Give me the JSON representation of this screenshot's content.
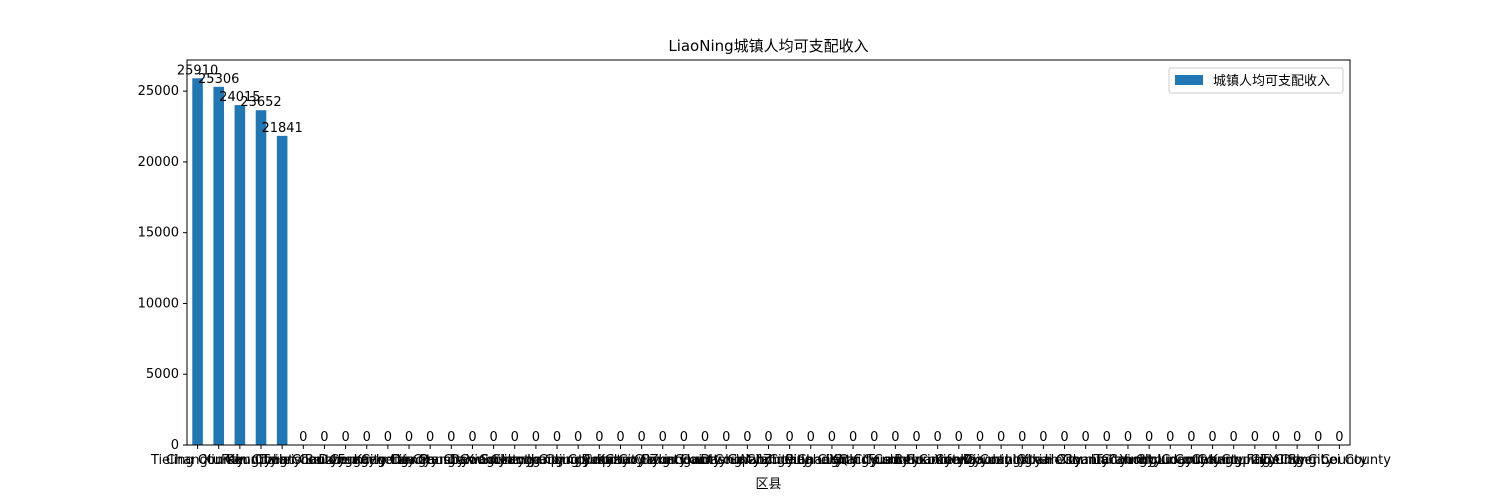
{
  "chart_data": {
    "type": "bar",
    "title": "LiaoNing城镇人均可支配收入",
    "xlabel": "区县",
    "ylabel": "",
    "ylim": [
      0,
      27200
    ],
    "yticks": [
      0,
      5000,
      10000,
      15000,
      20000,
      25000
    ],
    "grid": false,
    "legend_position": "top-right",
    "bar_color": "#1f77b4",
    "categories": [
      "Tieling County",
      "Changtu County",
      "Xinmin City",
      "Faku County",
      "Kangping County",
      "Taian County",
      "Heishan County",
      "Beizhen City",
      "Donggang City",
      "Fengcheng City",
      "Kuandian County",
      "Dengta City",
      "Liaoyang County",
      "Panshan County",
      "Dawa County",
      "Xingcheng City",
      "Suizhong County",
      "Jianchang County",
      "Jianping County",
      "Lingyuan City",
      "Beipiao City",
      "Kazuo County",
      "Chaoyang County",
      "Fuxin County",
      "Zhangwu County",
      "Haicheng City",
      "Dashiqiao City",
      "Gaizhou City",
      "Wafangdian City",
      "Zhuanghe City",
      "Pulandian City",
      "Changhai County",
      "Xinbin County",
      "Qingyuan County",
      "Fushun County",
      "Benxi County",
      "Huanren County",
      "Xifeng County",
      "Kaiyuan City",
      "Diaobingshan City",
      "Linghai City",
      "Yixian County",
      "Heishan City",
      "Xinmin County",
      "Tai'an City",
      "Liaozhong County",
      "Yingkou County",
      "Huludao County",
      "Lingyuan County",
      "Changtu City",
      "Kangping City",
      "Faku City",
      "Tieling City",
      "Yuhong County",
      "Shenbei County"
    ],
    "values": [
      25910,
      25306,
      24015,
      23652,
      21841,
      0,
      0,
      0,
      0,
      0,
      0,
      0,
      0,
      0,
      0,
      0,
      0,
      0,
      0,
      0,
      0,
      0,
      0,
      0,
      0,
      0,
      0,
      0,
      0,
      0,
      0,
      0,
      0,
      0,
      0,
      0,
      0,
      0,
      0,
      0,
      0,
      0,
      0,
      0,
      0,
      0,
      0,
      0,
      0,
      0,
      0,
      0,
      0,
      0,
      0
    ],
    "series": [
      {
        "name": "城镇人均可支配收入"
      }
    ]
  }
}
